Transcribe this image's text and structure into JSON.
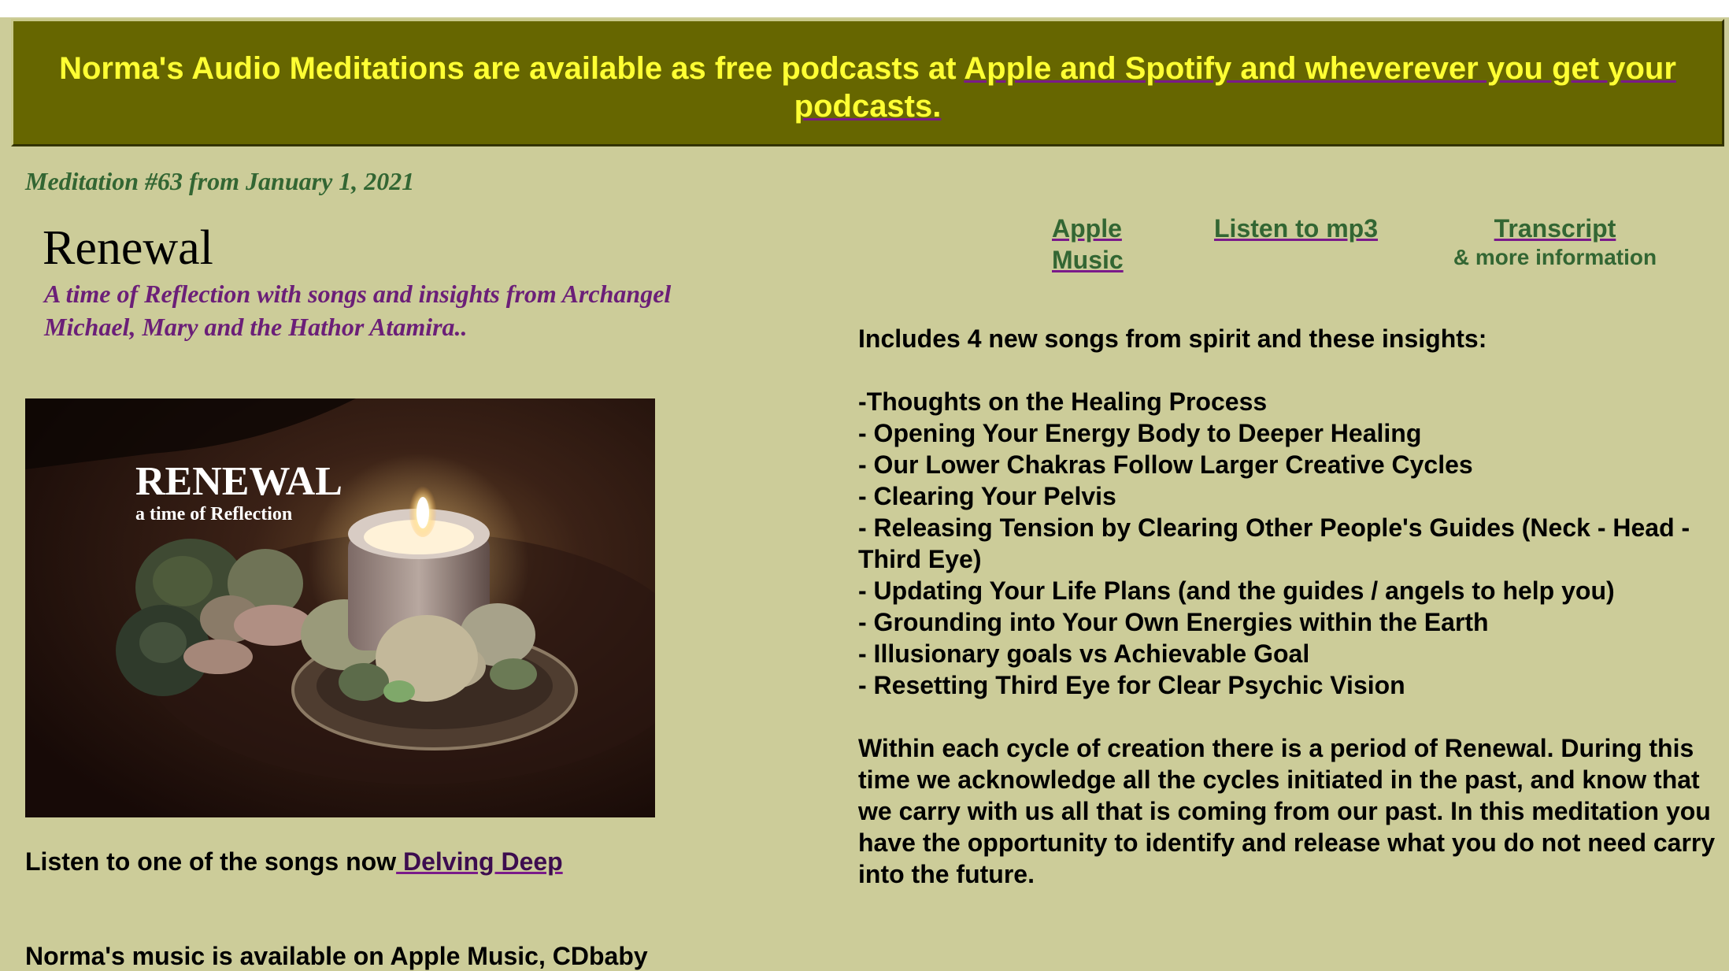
{
  "banner": {
    "text": "Norma's Audio Meditations are available as free podcasts at ",
    "link_text": "Apple and Spotify and wheverever you get your podcasts. "
  },
  "meditation_date": "Meditation #63 from January 1, 2021",
  "title": "Renewal",
  "subtitle": "A time of Reflection with songs and insights from Archangel Michael, Mary and the Hathor Atamira..",
  "image": {
    "title": "RENEWAL",
    "subtitle": "a time of Reflection"
  },
  "listen": {
    "text": "Listen to one of the songs now",
    "link": " Delving Deep"
  },
  "cut_off_text": "Norma's music is available on Apple Music, CDbaby",
  "links": {
    "apple": "Apple Music",
    "mp3": "Listen to mp3",
    "transcript": "Transcript",
    "transcript_sub": "& more information"
  },
  "content": {
    "intro": "Includes 4 new songs from spirit and these insights:",
    "insights": [
      "-Thoughts on the Healing Process",
      "- Opening Your Energy Body to Deeper Healing",
      "- Our Lower Chakras Follow Larger Creative Cycles",
      "- Clearing Your Pelvis",
      "- Releasing Tension by Clearing Other People's Guides (Neck - Head - Third Eye)",
      "- Updating Your Life Plans (and the guides / angels to help you)",
      "- Grounding into Your Own Energies within the Earth",
      "- Illusionary goals vs Achievable Goal",
      "- Resetting Third Eye for Clear Psychic Vision"
    ],
    "description": "Within each cycle of creation there is a period of Renewal. During this time we acknowledge all the cycles initiated in the past, and know that we carry with us all that is coming from our past. In this meditation you have the opportunity to identify and release what you do not need carry into the future."
  },
  "colors": {
    "page_background": "#cccc99",
    "banner_background": "#666600",
    "banner_text": "#ffff33",
    "date_and_links": "#336633",
    "subtitle": "#6b1f78"
  }
}
